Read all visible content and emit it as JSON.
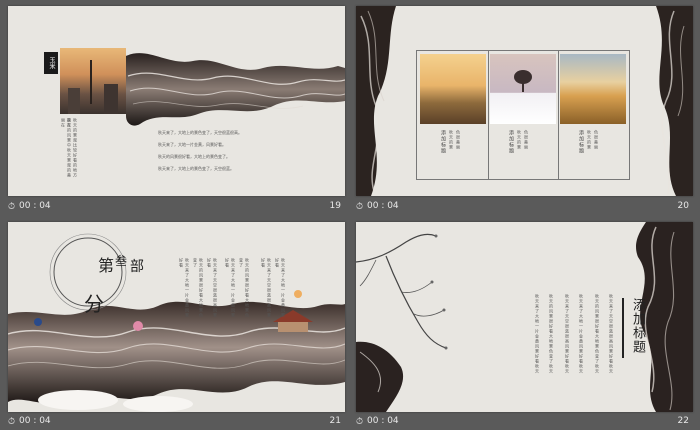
{
  "slides": [
    {
      "number": "19",
      "duration": "00 : 04",
      "badge": "玉米",
      "caption_lines": [
        "秋天的景观比较好看的地方是在",
        "秋天的风景中秋天景观的美丽在"
      ],
      "body_lines": [
        "秋天来了，大地上的景色变了，天空很蓝很高。",
        "秋天来了，大地一片金黄，风景好看。",
        "秋天的风景很好看，大地上的景色变了。",
        "秋天来了，大地上的景色变了，天空很蓝。"
      ]
    },
    {
      "number": "20",
      "duration": "00 : 04",
      "cards": [
        {
          "title": "添加标题",
          "lines": [
            "秋天的景",
            "色很美丽",
            "秋天来了"
          ]
        },
        {
          "title": "添加标题",
          "lines": [
            "秋天的景",
            "色很美丽",
            "秋天来了"
          ]
        },
        {
          "title": "添加标题",
          "lines": [
            "秋天的景",
            "色很美丽",
            "秋天来了"
          ]
        }
      ]
    },
    {
      "number": "21",
      "duration": "00 : 04",
      "section_chars": [
        "第",
        "叁",
        "部",
        "分"
      ],
      "columns": [
        "秋天来了大地一片金黄风景好看",
        "秋天的风景很好看大地景色变了",
        "秋天来了天空很蓝很高风景好看",
        "秋天来了大地一片金黄风景好看",
        "秋天的风景很好看大地景色变了",
        "秋天来了天空很蓝很高风景好看",
        "秋天来了大地一片金黄风景好看"
      ]
    },
    {
      "number": "22",
      "duration": "00 : 04",
      "title_chars": [
        "添",
        "加",
        "标",
        "题"
      ],
      "columns": [
        "秋天来了大地一片金黄风景好看秋天",
        "秋天的风景很好看大地景色变了秋天",
        "秋天来了天空很蓝很高风景好看秋天",
        "秋天来了大地一片金黄风景好看秋天",
        "秋天的风景很好看大地景色变了秋天",
        "秋天来了天空很蓝很高风景好看秋天"
      ]
    }
  ],
  "colors": {
    "background": "#5a5a5a",
    "paper": "#e8e6e1",
    "ink": "#1e1a18",
    "accent": "#c0392b"
  },
  "icons": [
    "clock-icon",
    "ink-wave-decoration",
    "plum-branch-decoration"
  ]
}
